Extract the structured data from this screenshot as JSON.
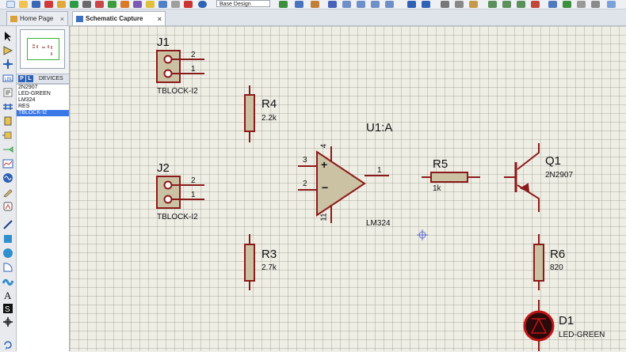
{
  "toolbar": {
    "design_combo": "Base Design"
  },
  "tabs": [
    {
      "label": "Home Page"
    },
    {
      "label": "Schematic Capture"
    }
  ],
  "devices": {
    "p_label": "P",
    "l_label": "L",
    "title": "DEVICES",
    "items": [
      "2N2907",
      "LED-GREEN",
      "LM324",
      "RES",
      "TBLOCK-I2"
    ],
    "selected_index": 4
  },
  "schematic": {
    "j1": {
      "ref": "J1",
      "value": "TBLOCK-I2",
      "pin_top": "2",
      "pin_bottom": "1"
    },
    "j2": {
      "ref": "J2",
      "value": "TBLOCK-I2",
      "pin_top": "2",
      "pin_bottom": "1"
    },
    "r4": {
      "ref": "R4",
      "value": "2.2k"
    },
    "r3": {
      "ref": "R3",
      "value": "2.7k"
    },
    "u1": {
      "ref": "U1:A",
      "value": "LM324",
      "pin_plus": "3",
      "pin_minus": "2",
      "pin_out": "1",
      "pin_vcc": "4",
      "pin_vee": "11"
    },
    "r5": {
      "ref": "R5",
      "value": "1k"
    },
    "q1": {
      "ref": "Q1",
      "value": "2N2907"
    },
    "r6": {
      "ref": "R6",
      "value": "820"
    },
    "d1": {
      "ref": "D1",
      "value": "LED-GREEN"
    }
  },
  "colors": {
    "wire": "#8b1a1a",
    "body_fill": "#cbc2a4",
    "led_fill": "#2a0a0a",
    "led_ring": "#c01515",
    "accent": "#2f62b4",
    "selection": "#3b78e7"
  }
}
